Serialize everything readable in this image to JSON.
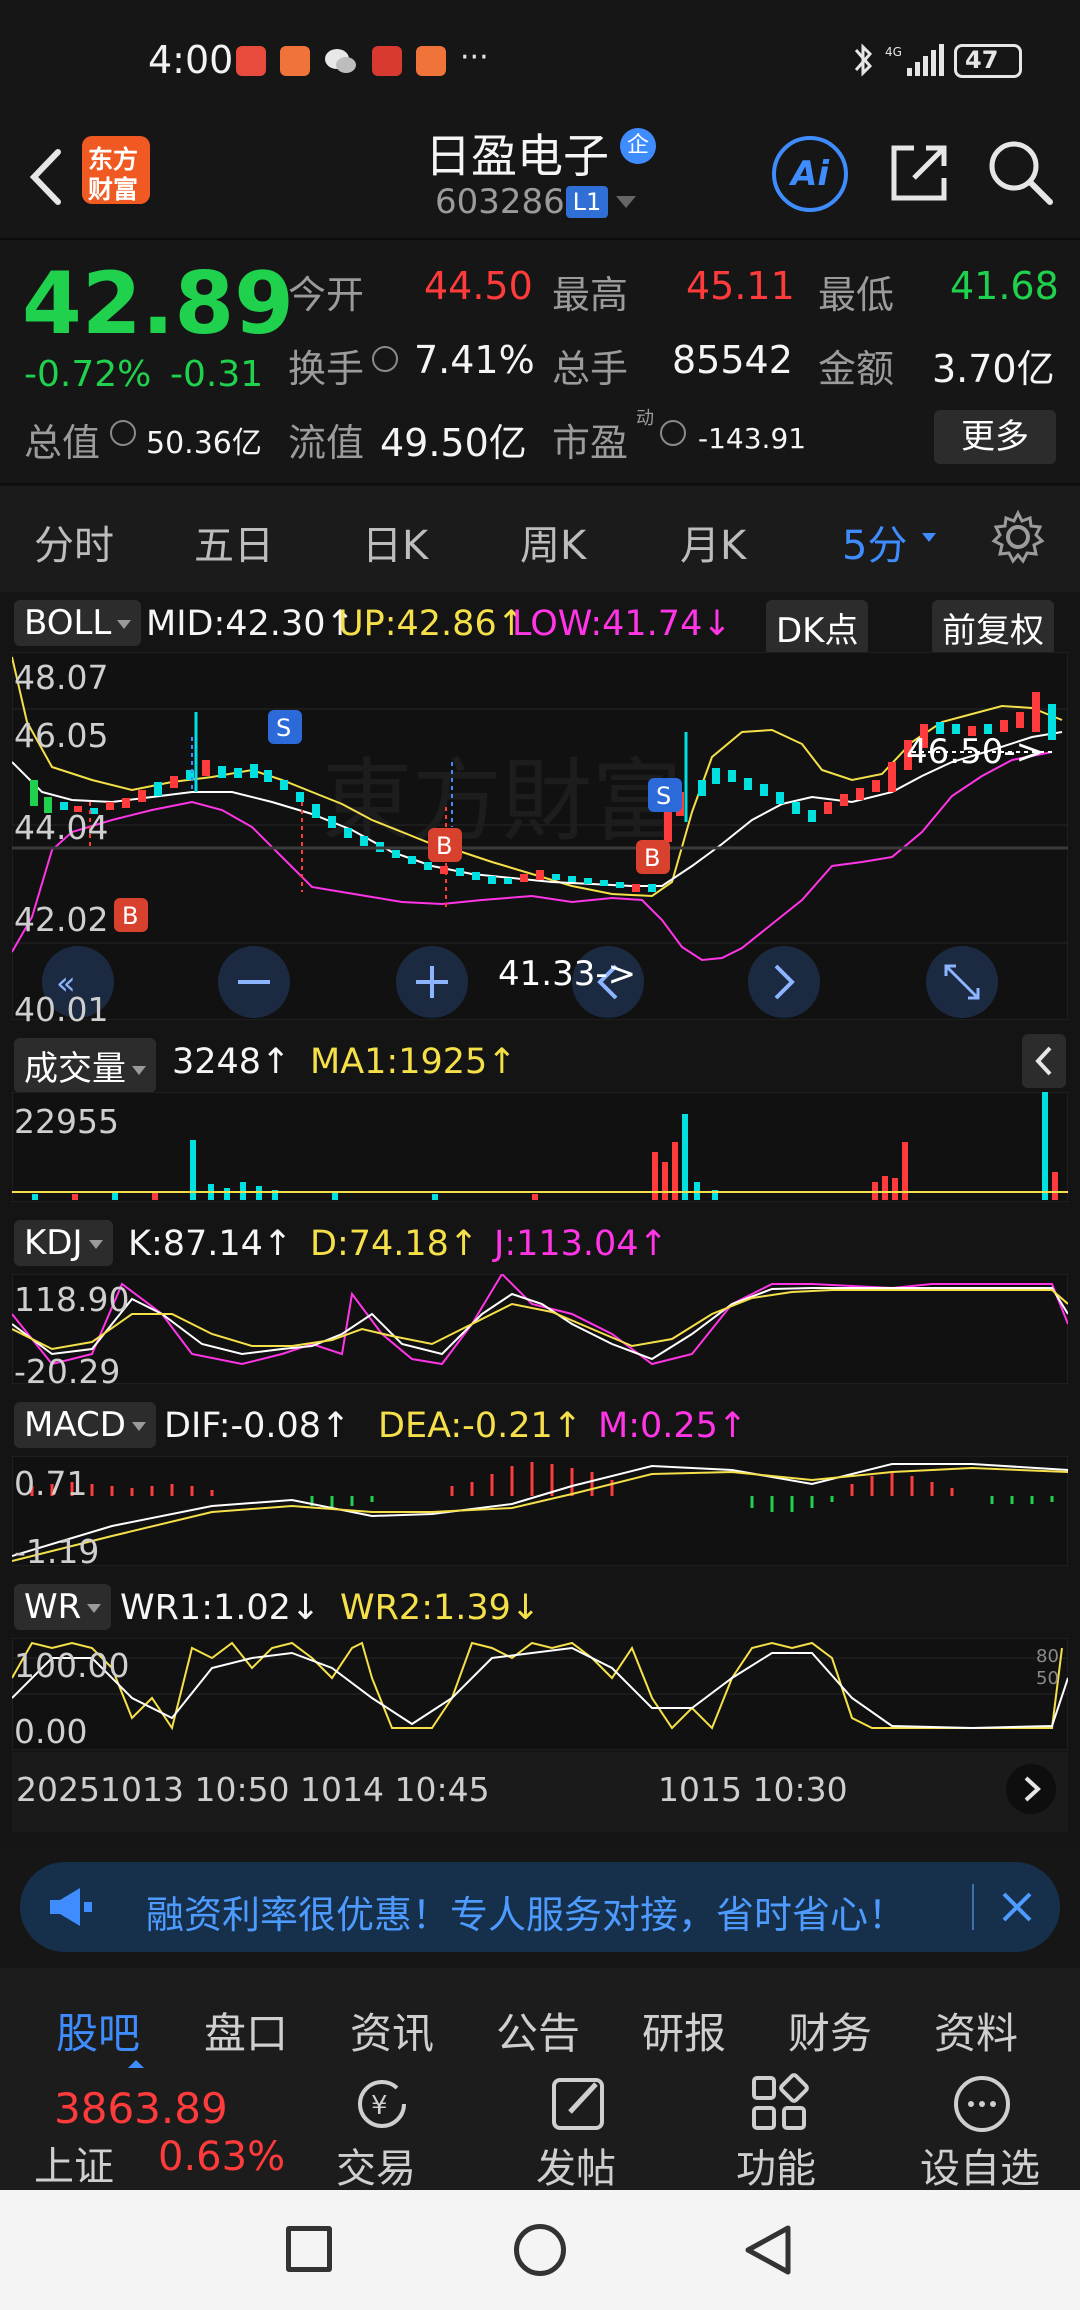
{
  "status_bar": {
    "time": "4:00",
    "more": "···",
    "battery": "47"
  },
  "header": {
    "logo_line1": "东方",
    "logo_line2": "财富",
    "stock_name": "日盈电子",
    "badge": "企",
    "code": "603286",
    "level": "L1",
    "ai_label": "Ai"
  },
  "quote": {
    "price": "42.89",
    "change_pct": "-0.72%",
    "change": "-0.31",
    "open_label": "今开",
    "open": "44.50",
    "high_label": "最高",
    "high": "45.11",
    "low_label": "最低",
    "low": "41.68",
    "turnover_label": "换手",
    "turnover": "7.41%",
    "volume_label": "总手",
    "volume": "85542",
    "amount_label": "金额",
    "amount": "3.70亿",
    "mktcap_label": "总值",
    "mktcap": "50.36亿",
    "float_label": "流值",
    "float": "49.50亿",
    "pe_label": "市盈",
    "pe_sup": "动",
    "pe": "-143.91",
    "more": "更多"
  },
  "period_tabs": [
    "分时",
    "五日",
    "日K",
    "周K",
    "月K",
    "5分"
  ],
  "boll": {
    "name": "BOLL",
    "mid": "MID:42.30↑",
    "up": "UP:42.86↑",
    "low": "LOW:41.74↓",
    "dk": "DK点",
    "adjust": "前复权"
  },
  "price_axis": [
    "48.07",
    "46.05",
    "44.04",
    "42.02",
    "40.01"
  ],
  "annotations": {
    "high_mark": "46.50->",
    "low_mark": "41.33->"
  },
  "volume": {
    "name": "成交量",
    "value": "3248↑",
    "ma1": "MA1:1925↑",
    "max": "22955"
  },
  "kdj": {
    "name": "KDJ",
    "k": "K:87.14↑",
    "d": "D:74.18↑",
    "j": "J:113.04↑",
    "top": "118.90",
    "bottom": "-20.29"
  },
  "macd": {
    "name": "MACD",
    "dif": "DIF:-0.08↑",
    "dea": "DEA:-0.21↑",
    "m": "M:0.25↑",
    "top": "0.71",
    "bottom": "-1.19"
  },
  "wr": {
    "name": "WR",
    "wr1": "WR1:1.02↓",
    "wr2": "WR2:1.39↓",
    "top": "100.00",
    "bottom": "0.00",
    "r80": "80",
    "r50": "50"
  },
  "time_axis": [
    "20251013 10:50",
    "1014 10:45",
    "1015 10:30"
  ],
  "banner": {
    "text": "融资利率很优惠！专人服务对接，省时省心！"
  },
  "bottom_tabs": [
    "股吧",
    "盘口",
    "资讯",
    "公告",
    "研报",
    "财务",
    "资料"
  ],
  "index": {
    "value": "3863.89",
    "name": "上证",
    "change": "0.63%"
  },
  "toolbar": {
    "trade": "交易",
    "post": "发帖",
    "func": "功能",
    "watch": "设自选"
  },
  "colors": {
    "up": "#ff3b3b",
    "down": "#1fd14c",
    "mid_line": "#ffffff",
    "up_line": "#f5e04a",
    "low_line": "#ff35e6",
    "accent_blue": "#3f8cff",
    "brand_orange": "#f05a22"
  }
}
